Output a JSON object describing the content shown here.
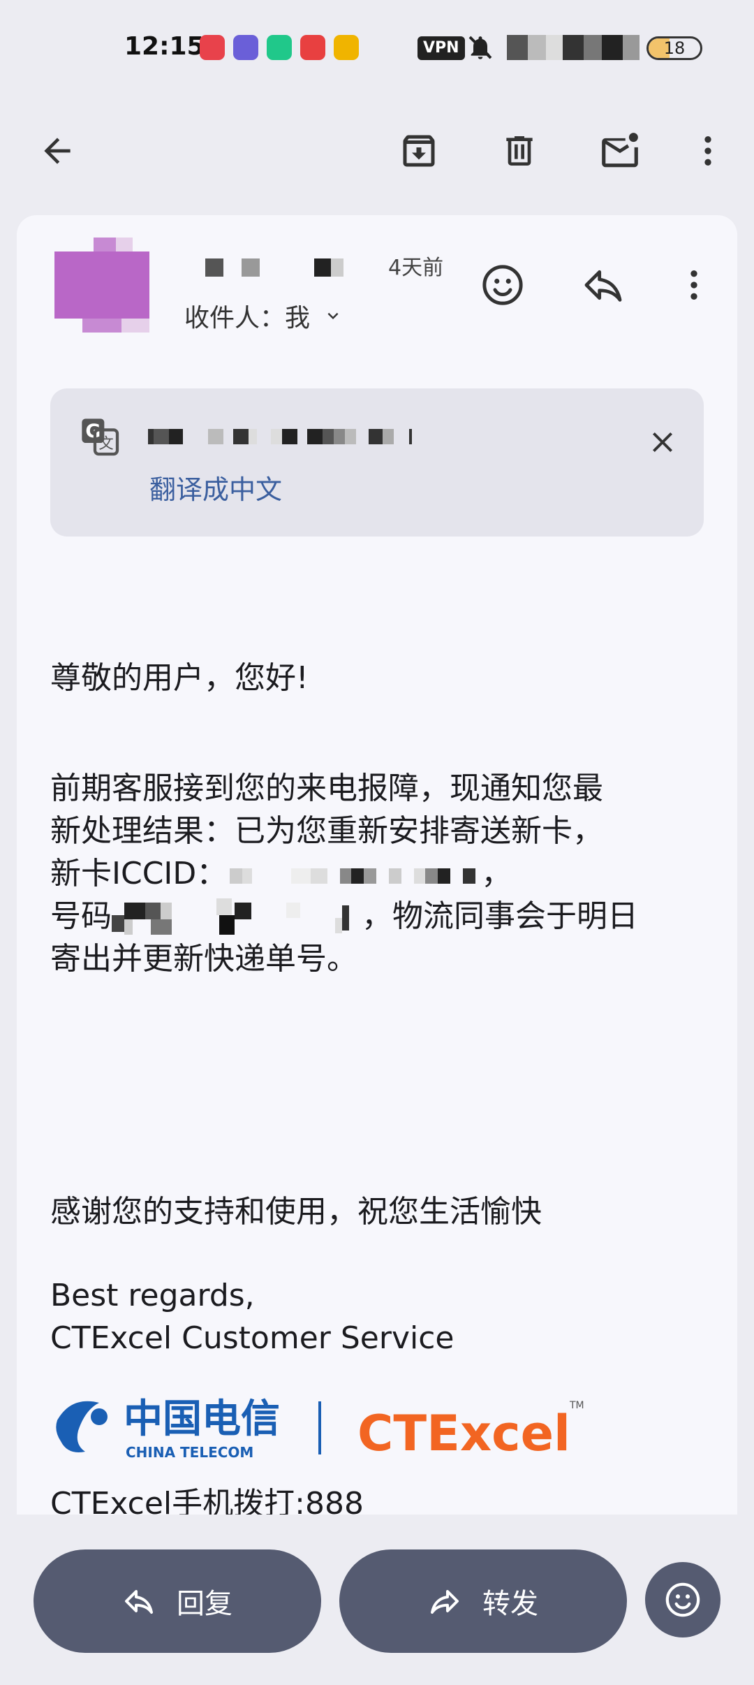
{
  "status_bar": {
    "time": "12:15",
    "vpn_label": "VPN",
    "battery_level": "18"
  },
  "toolbar": {
    "back": "back-arrow-icon",
    "archive": "archive-icon",
    "delete": "trash-icon",
    "mark_unread": "mark-unread-icon",
    "more": "more-vert-icon"
  },
  "email": {
    "date": "4天前",
    "recipient_label": "收件人：",
    "recipient_value": "我",
    "translate_link": "翻译成中文",
    "body": {
      "greeting": "尊敬的用户，您好!",
      "para_line1": " 前期客服接到您的来电报障，现通知您最",
      "para_line2": "新处理结果：已为您重新安排寄送新卡，",
      "para_line3_prefix": "新卡ICCID：",
      "para_line3_suffix": "，",
      "para_line4_prefix": "号码",
      "para_line4_suffix": "，物流同事会于明日",
      "para_line5": "寄出并更新快递单号。",
      "thanks": "感谢您的支持和使用，祝您生活愉快",
      "regards": "Best regards,",
      "signature": "CTExcel Customer Service",
      "logo_cn": "中国电信",
      "logo_en": "CHINA TELECOM",
      "logo_brand": "CTExcel",
      "logo_tm": "TM",
      "footer": "CTExcel手机拨打:888"
    }
  },
  "actions": {
    "reply": "回复",
    "forward": "转发"
  },
  "colors": {
    "avatar": "#b967c7",
    "link": "#3b5f9f",
    "pill": "#555b71",
    "telecom_blue": "#1a5fb4",
    "ctexcel_orange": "#f26522"
  }
}
